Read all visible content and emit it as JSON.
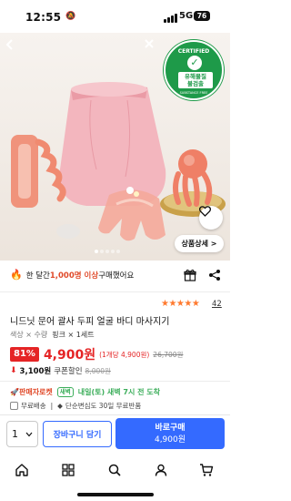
{
  "status_bar": {
    "time": "12:55",
    "network": "5G",
    "battery": "76"
  },
  "hero": {
    "certification": {
      "top_text": "CERTIFIED",
      "badge": "유해물질\n불검출",
      "bottom_text": "SUBSTANCE FREE"
    },
    "detail_button": "상품상세 >"
  },
  "popularity": {
    "prefix": "한 달간 ",
    "highlight": "1,000명 이상",
    "suffix": " 구매했어요"
  },
  "rating": {
    "stars": "★★★★★",
    "count": "42"
  },
  "product": {
    "title": "니드닛 문어 괄사 두피 얼굴 바디 마사지기",
    "option_label": "색상 × 수량",
    "option_value": "핑크 × 1세트"
  },
  "price": {
    "discount": "81%",
    "sale_price": "4,900원",
    "unit_price": "(1개당 4,900원)",
    "original_price": "26,700원"
  },
  "coupon": {
    "price": "3,100원",
    "label": "쿠폰할인",
    "original": "8,000원"
  },
  "delivery": {
    "seller": "판매자로켓",
    "tag": "새벽",
    "eta": "내일(토) 새벽 7시 전 도착"
  },
  "shipping": {
    "free": "무료배송",
    "safe_return": "단순변심도 30일 무료반품"
  },
  "buy_bar": {
    "quantity": "1",
    "cart_label": "장바구니 담기",
    "buy_label": "바로구매",
    "buy_price": "4,900원"
  },
  "tabs": [
    "home-icon",
    "category-icon",
    "search-icon",
    "my-page-icon",
    "cart-icon"
  ],
  "colors": {
    "accent": "#346aff",
    "sale_red": "#e52425",
    "rocket_green": "#3cae5b",
    "star_orange": "#ff7a2f"
  }
}
